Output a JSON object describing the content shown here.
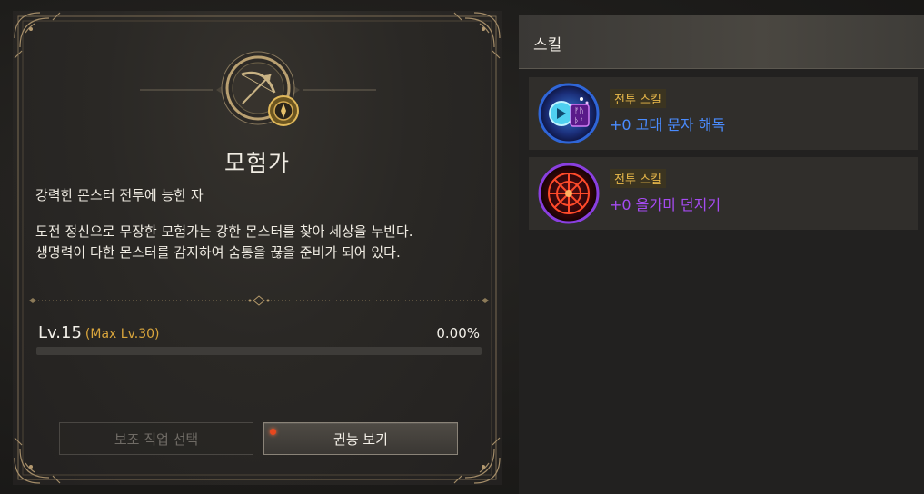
{
  "class_panel": {
    "class_name": "모험가",
    "subtitle": "강력한 몬스터 전투에 능한 자",
    "description_lines": [
      "도전 정신으로 무장한 모험가는 강한 몬스터를 찾아 세상을 누빈다.",
      "생명력이 다한 몬스터를 감지하여 숨통을 끊을 준비가 되어 있다."
    ],
    "level_label": "Lv.15",
    "max_level_label": "(Max Lv.30)",
    "exp_percent_text": "0.00%",
    "exp_fraction": 0.0,
    "sub_class_button": "보조 직업 선택",
    "ability_button": "권능 보기",
    "ability_notify_color": "#e8471e"
  },
  "skill_panel": {
    "title": "스킬",
    "skills": [
      {
        "tag": "전투 스킬",
        "name": "+0 고대 문자 해독",
        "name_color": "#4a8cff",
        "icon": "ancient-script-icon"
      },
      {
        "tag": "전투 스킬",
        "name": "+0 올가미 던지기",
        "name_color": "#a54bf0",
        "icon": "snare-net-icon"
      }
    ]
  },
  "colors": {
    "gold_accent": "#c9a55a",
    "max_level": "#d9a53c",
    "tag_text": "#e8b84a"
  }
}
